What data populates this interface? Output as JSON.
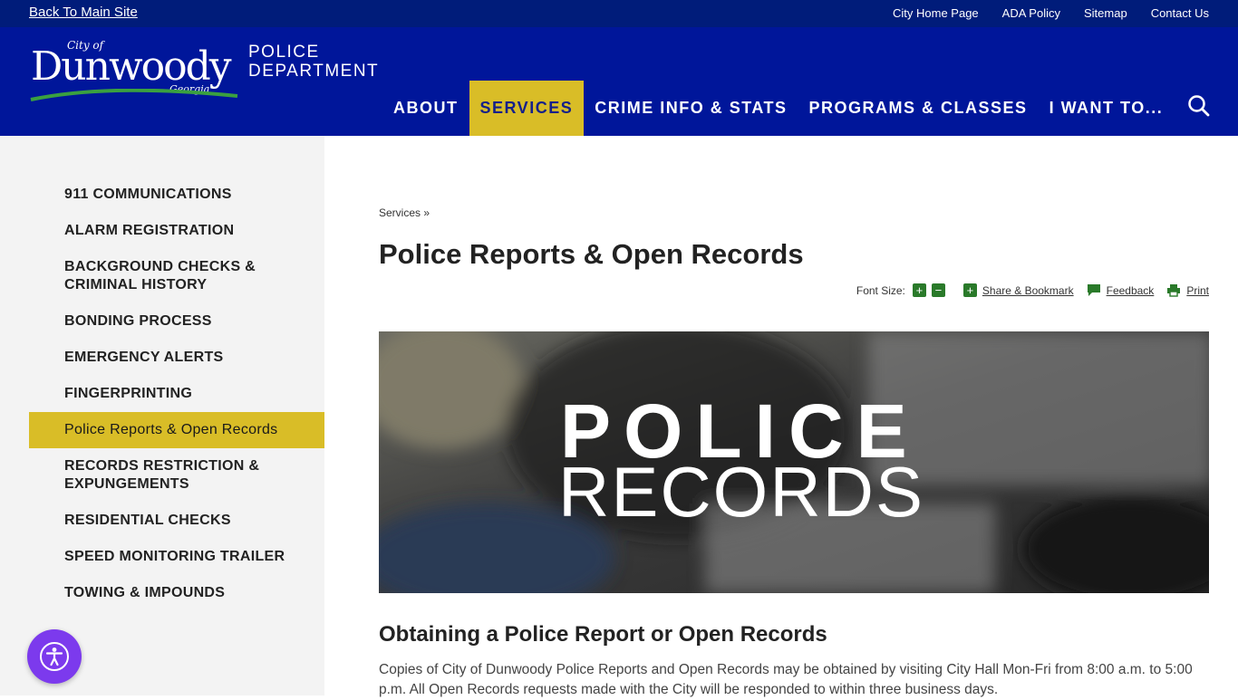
{
  "topbar": {
    "back_label": "Back To Main Site",
    "links": [
      "City Home Page",
      "ADA Policy",
      "Sitemap",
      "Contact Us"
    ]
  },
  "logo": {
    "city_of": "City of",
    "name": "Dunwoody",
    "state": "Georgia"
  },
  "dept": {
    "line1": "POLICE",
    "line2": "DEPARTMENT"
  },
  "nav": {
    "items": [
      "ABOUT",
      "SERVICES",
      "CRIME INFO & STATS",
      "PROGRAMS & CLASSES",
      "I WANT TO..."
    ],
    "active": "SERVICES"
  },
  "sidebar": {
    "items": [
      "911 COMMUNICATIONS",
      "ALARM REGISTRATION",
      "BACKGROUND CHECKS & CRIMINAL HISTORY",
      "BONDING PROCESS",
      "EMERGENCY ALERTS",
      "FINGERPRINTING",
      "Police Reports & Open Records",
      "RECORDS RESTRICTION & EXPUNGEMENTS",
      "RESIDENTIAL CHECKS",
      "SPEED MONITORING TRAILER",
      "TOWING & IMPOUNDS"
    ],
    "active_index": 6
  },
  "breadcrumb": "Services »",
  "page_title": "Police Reports & Open Records",
  "tools": {
    "font_size_label": "Font Size:",
    "increase": "+",
    "decrease": "−",
    "share_label": "Share & Bookmark",
    "feedback_label": "Feedback",
    "print_label": "Print"
  },
  "hero": {
    "line1": "POLICE",
    "line2": "RECORDS"
  },
  "section_heading": "Obtaining a Police Report or Open Records",
  "section_text": "Copies of City of Dunwoody Police Reports and Open Records may be obtained by visiting City Hall Mon-Fri from 8:00 a.m. to 5:00 p.m. All Open Records requests made with the City will be responded to within three business days.",
  "colors": {
    "topbar": "#001c7a",
    "header": "#00169a",
    "accent": "#d9bd27",
    "sidebar_bg": "#f3f3f3",
    "tool_green": "#2a7a2a",
    "a11y_purple": "#7c3aed"
  }
}
